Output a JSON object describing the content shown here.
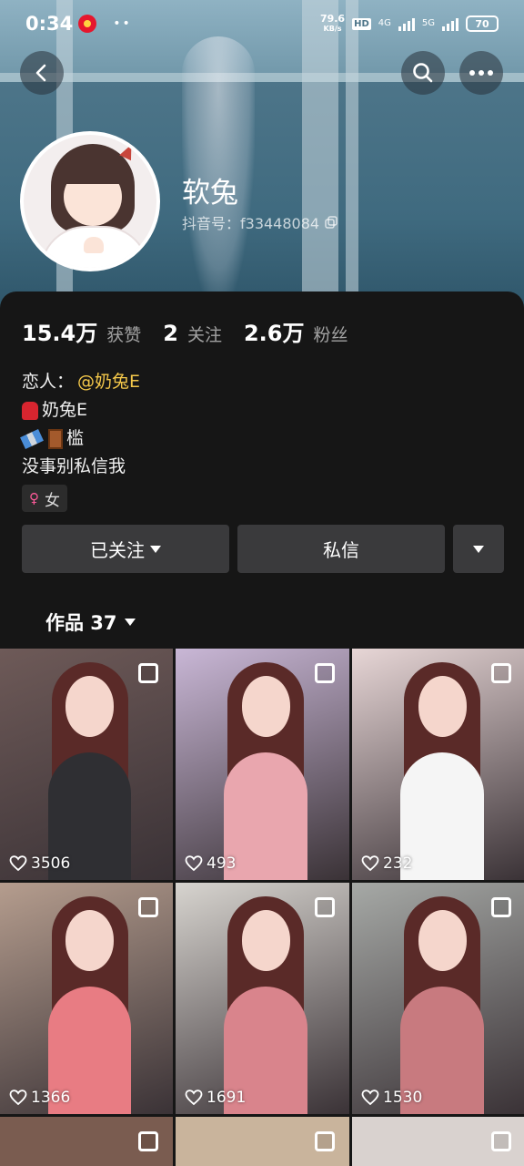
{
  "status_bar": {
    "time": "0:34",
    "speed_value": "79.6",
    "speed_unit": "KB/s",
    "hd_label": "HD",
    "net1": "4G",
    "net2": "5G",
    "battery": "70"
  },
  "profile": {
    "nickname": "软兔",
    "douyin_id": "抖音号：f33448084",
    "stats": [
      {
        "value": "15.4万",
        "label": "获赞"
      },
      {
        "value": "2",
        "label": "关注"
      },
      {
        "value": "2.6万",
        "label": "粉丝"
      }
    ],
    "bio": {
      "lover_prefix": "恋人：",
      "lover_mention": "@奶兔E",
      "line2": "奶兔E",
      "line3": "槛",
      "line4": "没事别私信我"
    },
    "gender": "女"
  },
  "actions": {
    "follow_label": "已关注",
    "dm_label": "私信"
  },
  "works": {
    "tab_label": "作品 37",
    "items": [
      {
        "likes": "3506",
        "bg": "#6e5a58",
        "shirt": "#2f2f33"
      },
      {
        "likes": "493",
        "bg": "#c9b7d6",
        "shirt": "#e9a6ae"
      },
      {
        "likes": "232",
        "bg": "#e7d6d6",
        "shirt": "#f5f5f5"
      },
      {
        "likes": "1366",
        "bg": "#b59d8e",
        "shirt": "#e87c83"
      },
      {
        "likes": "1691",
        "bg": "#d7d4cf",
        "shirt": "#d9848c"
      },
      {
        "likes": "1530",
        "bg": "#a6a9a6",
        "shirt": "#c87a7f"
      }
    ]
  },
  "colors": {
    "mention": "#f4c84a",
    "background": "#161616",
    "button": "#3a3a3c"
  }
}
